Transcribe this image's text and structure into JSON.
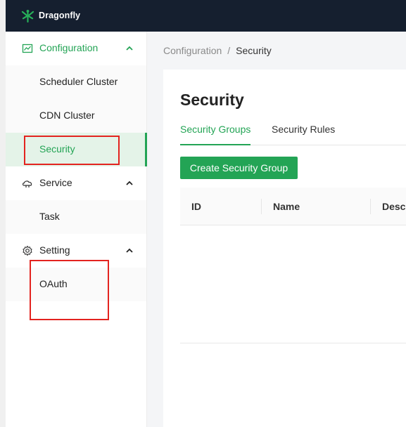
{
  "app": {
    "brand": "Dragonfly"
  },
  "sidebar": {
    "groups": [
      {
        "label": "Configuration",
        "icon": "line-chart-icon",
        "expanded": true,
        "items": [
          {
            "label": "Scheduler Cluster"
          },
          {
            "label": "CDN Cluster"
          },
          {
            "label": "Security",
            "selected": true
          }
        ]
      },
      {
        "label": "Service",
        "icon": "cloud-service-icon",
        "expanded": true,
        "items": [
          {
            "label": "Task"
          }
        ]
      },
      {
        "label": "Setting",
        "icon": "gear-icon",
        "expanded": true,
        "items": [
          {
            "label": "OAuth"
          }
        ]
      }
    ]
  },
  "breadcrumb": {
    "parent": "Configuration",
    "separator": "/",
    "current": "Security"
  },
  "page": {
    "title": "Security",
    "tabs": [
      {
        "label": "Security Groups",
        "active": true
      },
      {
        "label": "Security Rules",
        "active": false
      }
    ],
    "create_button": "Create Security Group",
    "table": {
      "columns": [
        "ID",
        "Name",
        "Descr"
      ]
    }
  },
  "colors": {
    "accent": "#23a455",
    "topbar": "#151f2f",
    "selected_bg": "#e4f3e8",
    "highlight": "#e3231f"
  }
}
